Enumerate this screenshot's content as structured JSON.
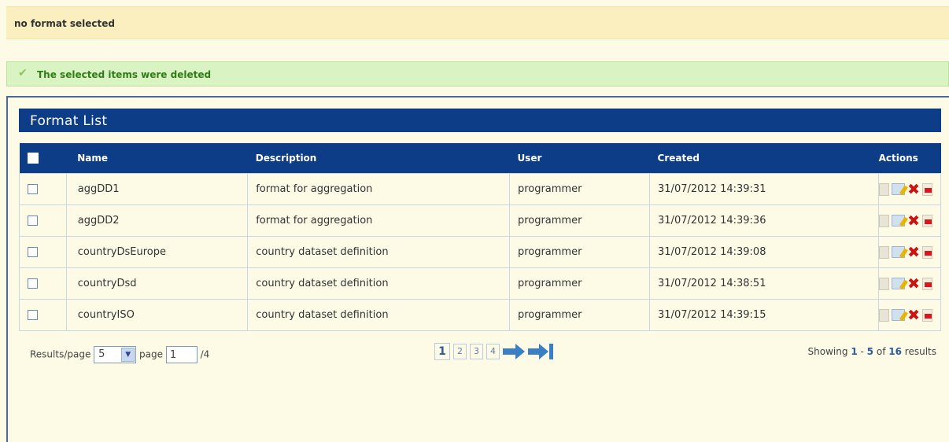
{
  "top_banner": {
    "text": "no format selected"
  },
  "success_banner": {
    "text": "The selected items were deleted"
  },
  "panel": {
    "title": "Format List"
  },
  "table": {
    "headers": {
      "name": "Name",
      "description": "Description",
      "user": "User",
      "created": "Created",
      "actions": "Actions"
    },
    "rows": [
      {
        "name": "aggDD1",
        "description": "format for aggregation",
        "user": "programmer",
        "created": "31/07/2012 14:39:31"
      },
      {
        "name": "aggDD2",
        "description": "format for aggregation",
        "user": "programmer",
        "created": "31/07/2012 14:39:36"
      },
      {
        "name": "countryDsEurope",
        "description": "country dataset definition",
        "user": "programmer",
        "created": "31/07/2012 14:39:08"
      },
      {
        "name": "countryDsd",
        "description": "country dataset definition",
        "user": "programmer",
        "created": "31/07/2012 14:38:51"
      },
      {
        "name": "countryISO",
        "description": "country dataset definition",
        "user": "programmer",
        "created": "31/07/2012 14:39:15"
      }
    ]
  },
  "footer": {
    "results_per_page_label": "Results/page",
    "results_per_page_value": "5",
    "page_label": "page",
    "page_value": "1",
    "page_total": "/4",
    "pages": [
      "1",
      "2",
      "3",
      "4"
    ],
    "showing_prefix": "Showing",
    "showing_from": "1",
    "showing_dash": "-",
    "showing_to": "5",
    "showing_of": "of",
    "showing_total": "16",
    "showing_suffix": "results"
  },
  "icons": {
    "success": "checkmark-icon",
    "row_actions": [
      "view-icon",
      "edit-icon",
      "delete-icon",
      "export-icon"
    ],
    "pager": [
      "next-page-icon",
      "last-page-icon"
    ]
  },
  "colors": {
    "header_blue": "#0d3d87",
    "success_green": "#2e7d16",
    "delete_red": "#c91414"
  }
}
